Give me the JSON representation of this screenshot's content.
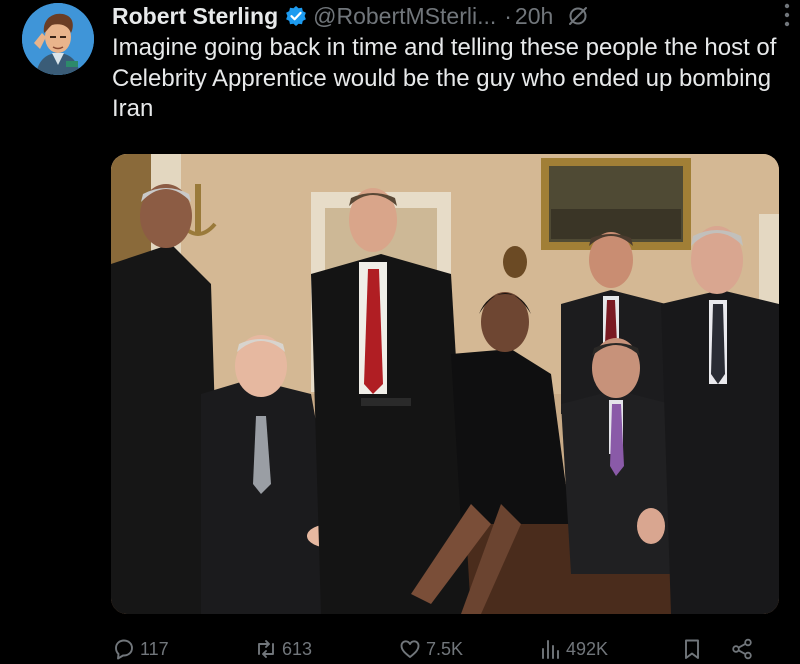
{
  "tweet": {
    "author": {
      "name": "Robert Sterling",
      "handle": "@RobertMSterli...",
      "separator": "·",
      "time": "20h"
    },
    "text": "Imagine going back in time and telling these people the host of Celebrity Apprentice would be the guy who ended up bombing Iran",
    "actions": {
      "replies": "117",
      "reposts": "613",
      "likes": "7.5K",
      "views": "492K"
    },
    "icons": {
      "verified": "verified-badge-icon",
      "grok": "grok-icon",
      "more": "more-icon",
      "reply": "reply-icon",
      "repost": "repost-icon",
      "like": "like-icon",
      "views": "views-icon",
      "bookmark": "bookmark-icon",
      "share": "share-icon"
    },
    "colors": {
      "background": "#000000",
      "text": "#e7e9ea",
      "muted": "#71767b",
      "verified": "#1d9bf0"
    }
  }
}
